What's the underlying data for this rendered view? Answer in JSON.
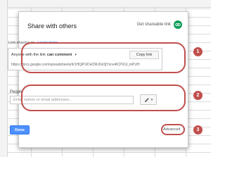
{
  "dialog": {
    "title": "Share with others",
    "get_link_label": "Get shareable link"
  },
  "link_sharing": {
    "status_label": "Link sharing on",
    "learn_more": "Learn more",
    "access_prefix": "Anyone with the link",
    "access_level": "can comment",
    "copy_link_label": "Copy link",
    "url": "https://docs.google.com/spreadsheets/d/1HQiPUDeO9U0xI3jYxnv4tCPiCd_mPUH"
  },
  "people": {
    "label": "People",
    "placeholder": "Enter names or email addresses..."
  },
  "footer": {
    "done_label": "Done",
    "advanced_label": "Advanced"
  },
  "callouts": {
    "one": "1",
    "two": "2",
    "three": "3"
  },
  "colors": {
    "callout": "#c0504d",
    "link_green": "#0f9d58",
    "done_blue": "#4d90fe",
    "learn_more_blue": "#1a73e8"
  }
}
